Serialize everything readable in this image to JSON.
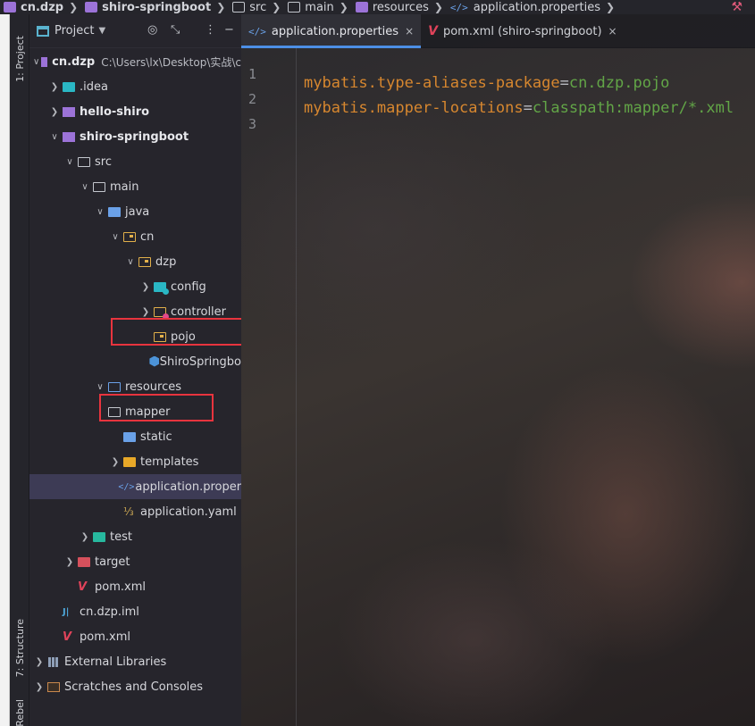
{
  "breadcrumb": {
    "items": [
      {
        "label": "cn.dzp",
        "bold": true,
        "icon": "module-icon"
      },
      {
        "label": "shiro-springboot",
        "bold": true,
        "icon": "module-icon"
      },
      {
        "label": "src",
        "bold": false,
        "icon": "folder-icon"
      },
      {
        "label": "main",
        "bold": false,
        "icon": "folder-icon"
      },
      {
        "label": "resources",
        "bold": false,
        "icon": "resources-folder-icon"
      },
      {
        "label": "application.properties",
        "bold": false,
        "icon": "properties-file-icon"
      }
    ]
  },
  "toolstrip": {
    "project_tab": "1: Project",
    "structure_tab": "7: Structure",
    "rebel_tab": "Rebel"
  },
  "project_panel": {
    "title": "Project",
    "tree": [
      {
        "label": "cn.dzp",
        "path": "C:\\Users\\lx\\Desktop\\实战\\c",
        "arrow": "down",
        "icon": "module",
        "bold": true
      },
      {
        "label": ".idea",
        "arrow": "right",
        "icon": "teal-folder"
      },
      {
        "label": "hello-shiro",
        "arrow": "right",
        "icon": "module",
        "bold": true
      },
      {
        "label": "shiro-springboot",
        "arrow": "down",
        "icon": "module",
        "bold": true
      },
      {
        "label": "src",
        "arrow": "down",
        "icon": "folder"
      },
      {
        "label": "main",
        "arrow": "down",
        "icon": "folder"
      },
      {
        "label": "java",
        "arrow": "down",
        "icon": "blue-folder"
      },
      {
        "label": "cn",
        "arrow": "down",
        "icon": "package"
      },
      {
        "label": "dzp",
        "arrow": "down",
        "icon": "package"
      },
      {
        "label": "config",
        "arrow": "right",
        "icon": "config-package"
      },
      {
        "label": "controller",
        "arrow": "right",
        "icon": "controller-package"
      },
      {
        "label": "pojo",
        "arrow": "none",
        "icon": "package"
      },
      {
        "label": "ShiroSpringbo",
        "arrow": "none",
        "icon": "spring-class"
      },
      {
        "label": "resources",
        "arrow": "down",
        "icon": "resources-folder"
      },
      {
        "label": "mapper",
        "arrow": "none",
        "icon": "folder"
      },
      {
        "label": "static",
        "arrow": "none",
        "icon": "static-folder"
      },
      {
        "label": "templates",
        "arrow": "right",
        "icon": "templates-folder"
      },
      {
        "label": "application.propert",
        "arrow": "none",
        "icon": "properties-file",
        "selected": true
      },
      {
        "label": "application.yaml",
        "arrow": "none",
        "icon": "yaml-file"
      },
      {
        "label": "test",
        "arrow": "right",
        "icon": "test-folder"
      },
      {
        "label": "target",
        "arrow": "right",
        "icon": "target-folder"
      },
      {
        "label": "pom.xml",
        "arrow": "none",
        "icon": "maven-file"
      },
      {
        "label": "cn.dzp.iml",
        "arrow": "none",
        "icon": "iml-file"
      },
      {
        "label": "pom.xml",
        "arrow": "none",
        "icon": "maven-file"
      },
      {
        "label": "External Libraries",
        "arrow": "right",
        "icon": "libraries"
      },
      {
        "label": "Scratches and Consoles",
        "arrow": "right",
        "icon": "scratches"
      }
    ]
  },
  "editor": {
    "tabs": [
      {
        "label": "application.properties",
        "active": true,
        "icon": "properties-file-icon"
      },
      {
        "label": "pom.xml (shiro-springboot)",
        "active": false,
        "icon": "maven-file-icon"
      }
    ],
    "line_numbers": [
      "1",
      "2",
      "3"
    ],
    "lines": [
      {
        "key": "",
        "eq": "",
        "value": ""
      },
      {
        "key": "mybatis.type-aliases-package",
        "eq": "=",
        "value": "cn.dzp.pojo"
      },
      {
        "key": "mybatis.mapper-locations",
        "eq": "=",
        "value": "classpath:mapper/*.xml"
      }
    ]
  },
  "colors": {
    "accent": "#4c8fe6",
    "highlight_box": "#e8343e",
    "property_key": "#d7872f",
    "property_value": "#62a547"
  }
}
